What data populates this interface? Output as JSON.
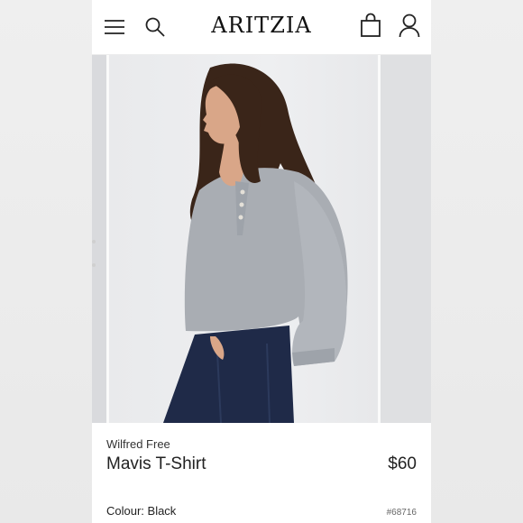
{
  "header": {
    "logo": "ARITZIA",
    "icons": [
      "menu-icon",
      "search-icon",
      "shopping-bag-icon",
      "account-icon"
    ]
  },
  "product": {
    "brand": "Wilfred Free",
    "name": "Mavis T-Shirt",
    "price": "$60",
    "colour_label": "Colour: Black",
    "sku": "#68716"
  },
  "colors": {
    "sweater": "#a9adb3",
    "jeans": "#1f2a48",
    "hair": "#3a2519",
    "skin": "#d9a688"
  }
}
